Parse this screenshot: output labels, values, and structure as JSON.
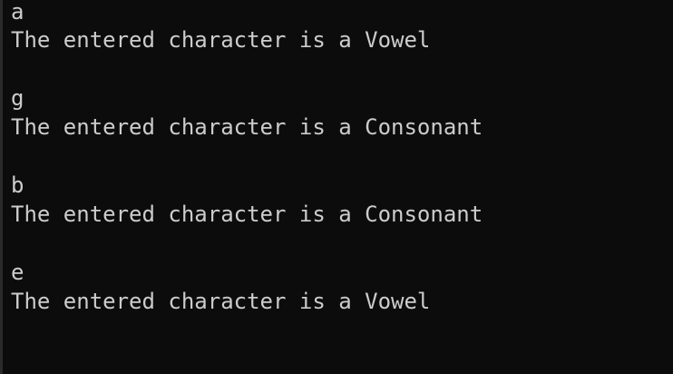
{
  "terminal": {
    "lines": [
      "a",
      "The entered character is a Vowel",
      "g",
      "The entered character is a Consonant",
      "b",
      "The entered character is a Consonant",
      "e",
      "The entered character is a Vowel"
    ]
  }
}
